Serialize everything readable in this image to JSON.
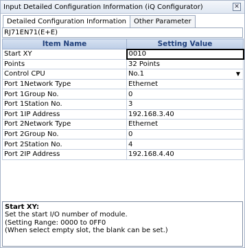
{
  "window": {
    "title": "Input Detailed Configuration Information (iQ Configurator)",
    "close_glyph": "✕"
  },
  "tabs": [
    {
      "label": "Detailed Configuration Information"
    },
    {
      "label": "Other Parameter"
    }
  ],
  "module": {
    "name": "RJ71EN71(E+E)"
  },
  "grid": {
    "headers": {
      "item": "Item Name",
      "value": "Setting Value"
    },
    "rows": [
      {
        "item": "Start XY",
        "value": "0010"
      },
      {
        "item": "Points",
        "value": "32 Points"
      },
      {
        "item": "Control CPU",
        "value": "No.1"
      },
      {
        "item": "Port 1Network Type",
        "value": "Ethernet"
      },
      {
        "item": "Port 1Group No.",
        "value": "0"
      },
      {
        "item": "Port 1Station No.",
        "value": "3"
      },
      {
        "item": "Port 1IP Address",
        "value": "192.168.3.40"
      },
      {
        "item": "Port 2Network Type",
        "value": "Ethernet"
      },
      {
        "item": "Port 2Group No.",
        "value": "0"
      },
      {
        "item": "Port 2Station No.",
        "value": "4"
      },
      {
        "item": "Port 2IP Address",
        "value": "192.168.4.40"
      }
    ],
    "dropdown_glyph": "▼"
  },
  "help": {
    "title": "Start XY:",
    "lines": [
      "Set the start I/O number of module.",
      "(Setting Range: 0000 to 0FF0",
      "(When select empty slot, the blank can be set.)"
    ]
  },
  "icons": {
    "close": "close-icon",
    "dropdown": "chevron-down-icon"
  }
}
